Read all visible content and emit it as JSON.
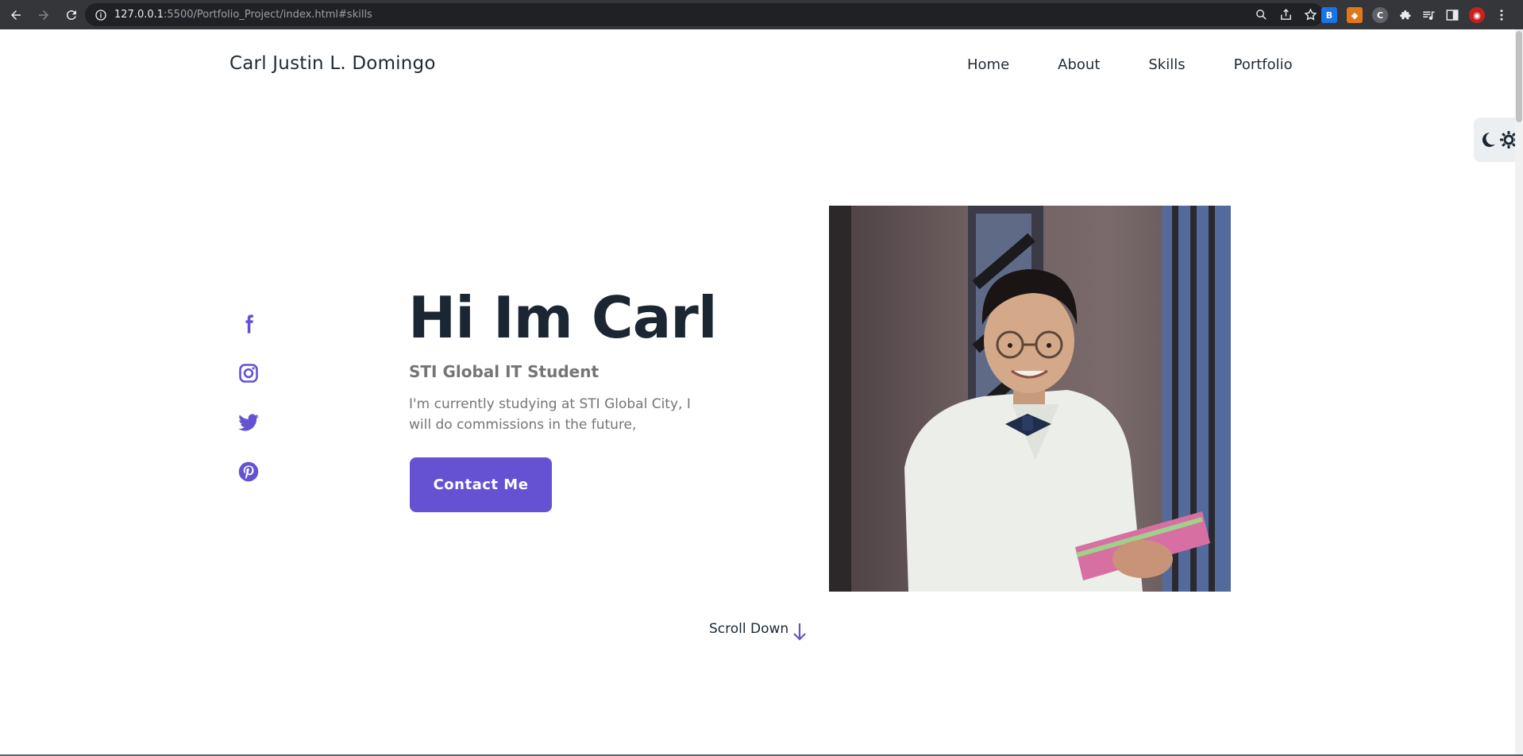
{
  "browser": {
    "url_host": "127.0.0.1",
    "url_rest": ":5500/Portfolio_Project/index.html#skills"
  },
  "header": {
    "logo": "Carl Justin L. Domingo",
    "nav": [
      {
        "label": "Home"
      },
      {
        "label": "About"
      },
      {
        "label": "Skills"
      },
      {
        "label": "Portfolio"
      }
    ]
  },
  "hero": {
    "title": "Hi Im Carl",
    "subtitle": "STI Global IT Student",
    "description": "I'm currently studying at STI Global City, I will do commissions in the future,",
    "button": "Contact Me",
    "scroll_label": "Scroll Down"
  },
  "socials": [
    "facebook-icon",
    "instagram-icon",
    "twitter-icon",
    "pinterest-icon"
  ],
  "colors": {
    "accent": "#6452d2",
    "heading": "#1a2733",
    "muted": "#757575"
  }
}
